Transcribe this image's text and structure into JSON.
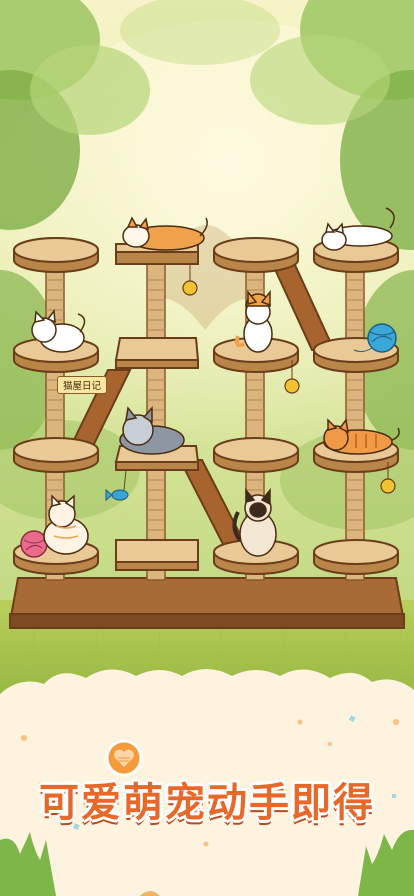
{
  "scene": {
    "sign_text": "猫屋日记",
    "slogan": "可爱萌宠动手即得"
  },
  "colors": {
    "wood_top": "#e7c797",
    "wood_edge": "#7a4a22",
    "post": "#d9b27d",
    "slogan": "#e8682a",
    "banner": "#fdf3df"
  },
  "icons": [
    "heart-badge-icon",
    "bell-icon",
    "yarn-ball-icon",
    "fish-toy-icon",
    "cat-icon"
  ]
}
